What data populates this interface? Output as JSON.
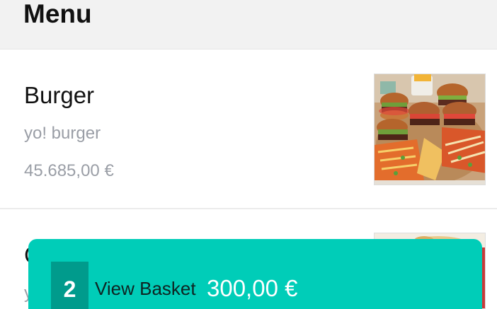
{
  "header": {
    "title": "Menu"
  },
  "items": [
    {
      "name": "Burger",
      "description": "yo! burger",
      "price": "45.685,00 €",
      "image": "burger-platter-photo"
    },
    {
      "name": "C",
      "description": "y",
      "image": "food-photo"
    }
  ],
  "basket": {
    "count": "2",
    "label": "View Basket",
    "total": "300,00 €"
  },
  "colors": {
    "accent": "#00cdb8",
    "accent_dark": "#009b8c",
    "header_bg": "#f2f2f2",
    "muted_text": "#9a9ea6"
  }
}
